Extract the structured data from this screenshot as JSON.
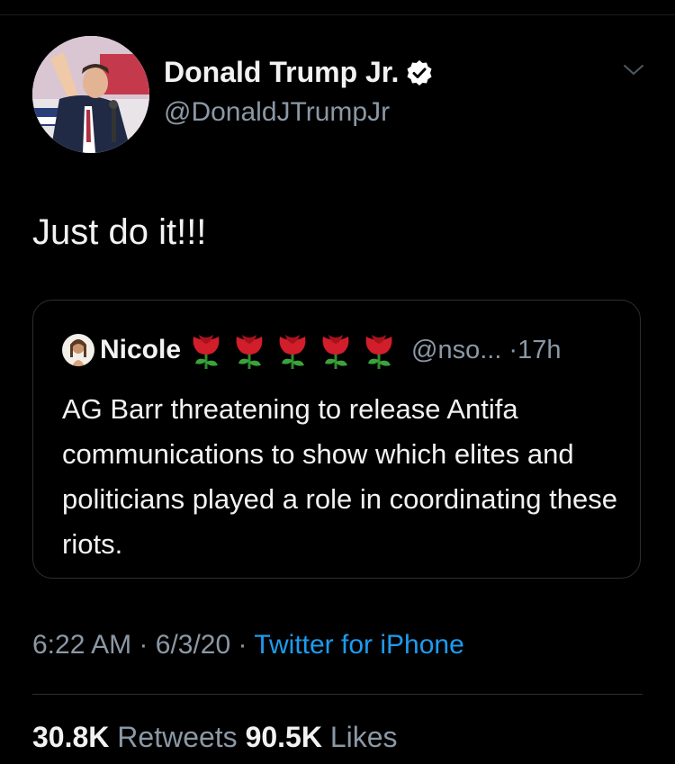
{
  "tweet": {
    "author": {
      "name": "Donald Trump Jr.",
      "handle": "@DonaldJTrumpJr",
      "verified": true,
      "avatar_icon": "profile-photo",
      "verified_icon": "verified-badge-icon"
    },
    "text": "Just do it!!!",
    "quoted_tweet": {
      "author_name": "Nicole",
      "author_handle": "@nso...",
      "separator": "·",
      "age": "17h",
      "name_decoration_icons": [
        "rose-icon",
        "rose-icon",
        "rose-icon",
        "rose-icon",
        "rose-icon"
      ],
      "text": "AG Barr threatening to release Antifa communications to show which elites and politicians played a role in coordinating these riots."
    },
    "meta": {
      "time": "6:22 AM",
      "separator": "·",
      "date": "6/3/20",
      "source": "Twitter for iPhone"
    },
    "stats": {
      "retweets_count": "30.8K",
      "retweets_label": "Retweets",
      "likes_count": "90.5K",
      "likes_label": "Likes"
    }
  },
  "colors": {
    "background": "#000000",
    "primary_text": "#f2f2f2",
    "secondary_text": "#8b98a5",
    "link": "#1d9bf0",
    "border": "#2b2f33"
  }
}
